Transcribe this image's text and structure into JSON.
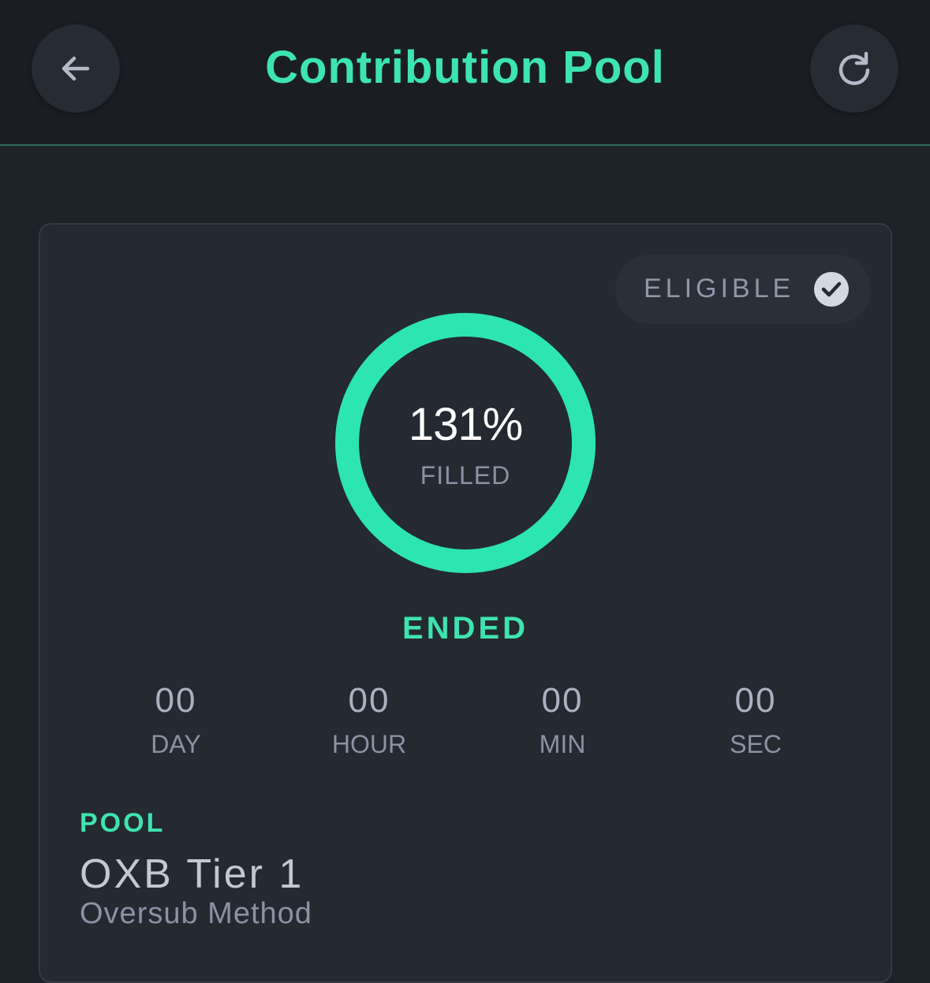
{
  "header": {
    "title": "Contribution Pool",
    "back_icon": "arrow-left-icon",
    "refresh_icon": "refresh-icon"
  },
  "pool_card": {
    "eligibility": {
      "label": "ELIGIBLE",
      "icon": "check-circle-icon"
    },
    "progress": {
      "value_text": "131%",
      "label": "FILLED",
      "fraction": 1.0
    },
    "status": "ENDED",
    "countdown": [
      {
        "value": "00",
        "unit": "DAY"
      },
      {
        "value": "00",
        "unit": "HOUR"
      },
      {
        "value": "00",
        "unit": "MIN"
      },
      {
        "value": "00",
        "unit": "SEC"
      }
    ],
    "pool": {
      "label": "POOL",
      "name": "OXB Tier 1",
      "method": "Oversub Method"
    }
  },
  "colors": {
    "accent": "#3ee4b0",
    "ring": "#2de5b0",
    "background": "#1e232a",
    "card": "#242932",
    "muted_text": "#8a92a4"
  }
}
